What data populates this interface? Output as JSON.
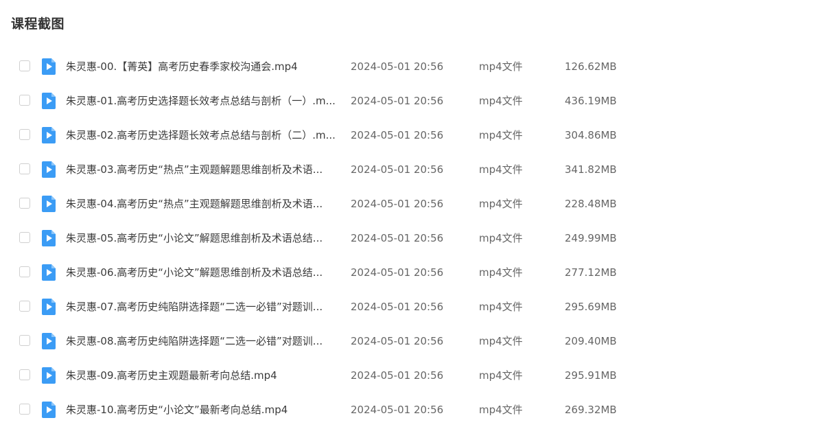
{
  "section": {
    "title": "课程截图"
  },
  "accent_color": "#3b9cf5",
  "file_icon": "video-file-icon",
  "files": [
    {
      "name": "朱灵惠-00.【菁英】高考历史春季家校沟通会.mp4",
      "date": "2024-05-01 20:56",
      "type": "mp4文件",
      "size": "126.62MB"
    },
    {
      "name": "朱灵惠-01.高考历史选择题长效考点总结与剖析（一）.m...",
      "date": "2024-05-01 20:56",
      "type": "mp4文件",
      "size": "436.19MB"
    },
    {
      "name": "朱灵惠-02.高考历史选择题长效考点总结与剖析（二）.m...",
      "date": "2024-05-01 20:56",
      "type": "mp4文件",
      "size": "304.86MB"
    },
    {
      "name": "朱灵惠-03.高考历史“热点”主观题解题思维剖析及术语...",
      "date": "2024-05-01 20:56",
      "type": "mp4文件",
      "size": "341.82MB"
    },
    {
      "name": "朱灵惠-04.高考历史“热点”主观题解题思维剖析及术语...",
      "date": "2024-05-01 20:56",
      "type": "mp4文件",
      "size": "228.48MB"
    },
    {
      "name": "朱灵惠-05.高考历史“小论文”解题思维剖析及术语总结...",
      "date": "2024-05-01 20:56",
      "type": "mp4文件",
      "size": "249.99MB"
    },
    {
      "name": "朱灵惠-06.高考历史“小论文”解题思维剖析及术语总结...",
      "date": "2024-05-01 20:56",
      "type": "mp4文件",
      "size": "277.12MB"
    },
    {
      "name": "朱灵惠-07.高考历史纯陷阱选择题“二选一必错”对题训...",
      "date": "2024-05-01 20:56",
      "type": "mp4文件",
      "size": "295.69MB"
    },
    {
      "name": "朱灵惠-08.高考历史纯陷阱选择题“二选一必错”对题训...",
      "date": "2024-05-01 20:56",
      "type": "mp4文件",
      "size": "209.40MB"
    },
    {
      "name": "朱灵惠-09.高考历史主观题最新考向总结.mp4",
      "date": "2024-05-01 20:56",
      "type": "mp4文件",
      "size": "295.91MB"
    },
    {
      "name": "朱灵惠-10.高考历史“小论文”最新考向总结.mp4",
      "date": "2024-05-01 20:56",
      "type": "mp4文件",
      "size": "269.32MB"
    }
  ]
}
